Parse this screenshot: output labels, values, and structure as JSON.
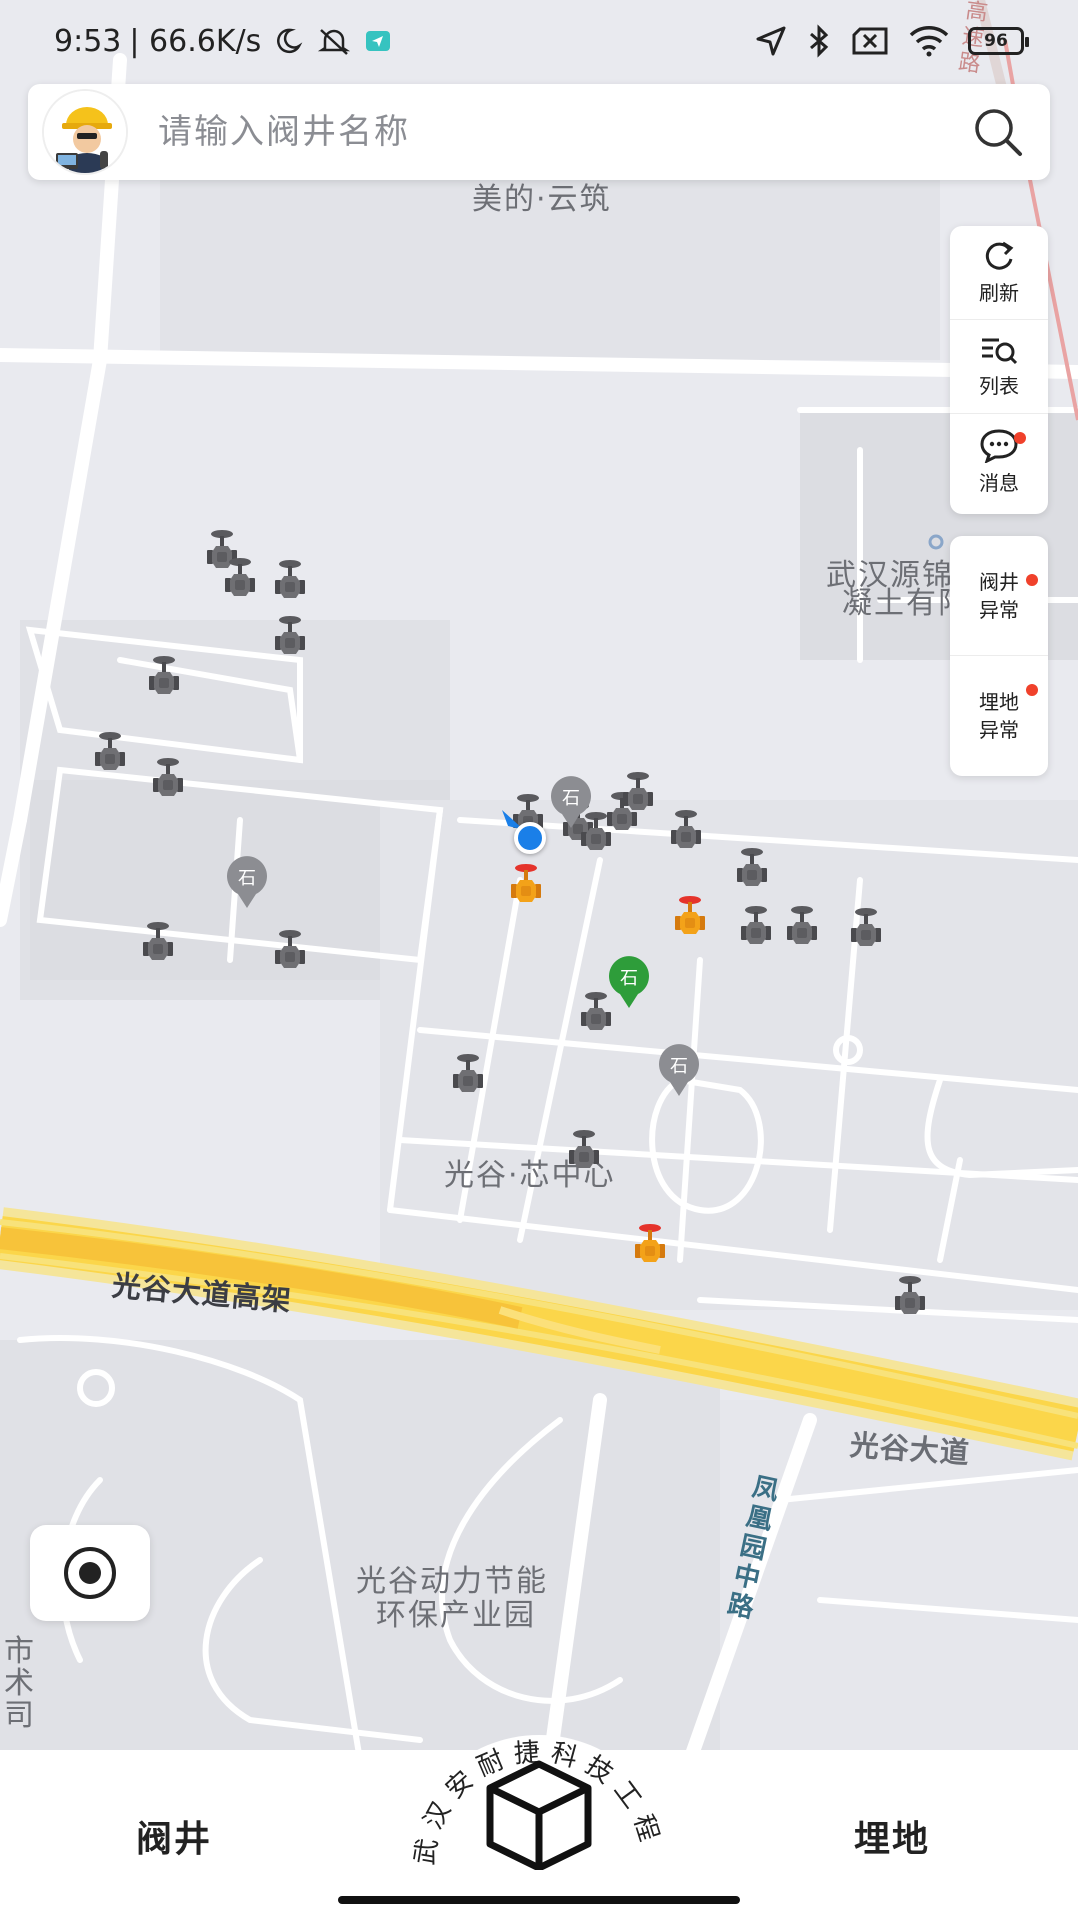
{
  "status_bar": {
    "time": "9:53",
    "network_speed": "| 66.6K/s",
    "battery": "96",
    "icons": [
      "moon-icon",
      "mute-icon",
      "app-notification-icon",
      "location-arrow-icon",
      "bluetooth-icon",
      "sim-disabled-icon",
      "wifi-icon",
      "battery-icon"
    ]
  },
  "search": {
    "placeholder": "请输入阀井名称",
    "avatar_icon": "worker-avatar-icon",
    "search_icon": "search-icon"
  },
  "toolbar": {
    "refresh": "刷新",
    "list": "列表",
    "messages": "消息",
    "valve_anomaly": "阀井异常",
    "buried_anomaly": "埋地异常"
  },
  "map_labels": {
    "meidi": "美的·云筑",
    "wuhan_company_line1": "武汉源锦",
    "wuhan_company_line2": "凝土有限",
    "guanggu_core": "光谷·芯中心",
    "guanggu_elevated": "光谷大道高架",
    "guanggu_avenue": "光谷大道",
    "fenghuang_road": "凤凰园中路",
    "park_line1": "光谷动力节能",
    "park_line2": "环保产业园",
    "left_edge": "市术司",
    "highway_top": "高速路"
  },
  "bottom_nav": {
    "valve": "阀井",
    "buried": "埋地",
    "center_text": "武汉安耐捷科技工程…"
  },
  "colors": {
    "accent_red": "#f0412b",
    "location_blue": "#1a7fe8",
    "road_yellow": "#fbd64a",
    "marker_gray": "#6f6f73",
    "marker_orange": "#f3a219",
    "marker_green": "#2e9d3a"
  }
}
